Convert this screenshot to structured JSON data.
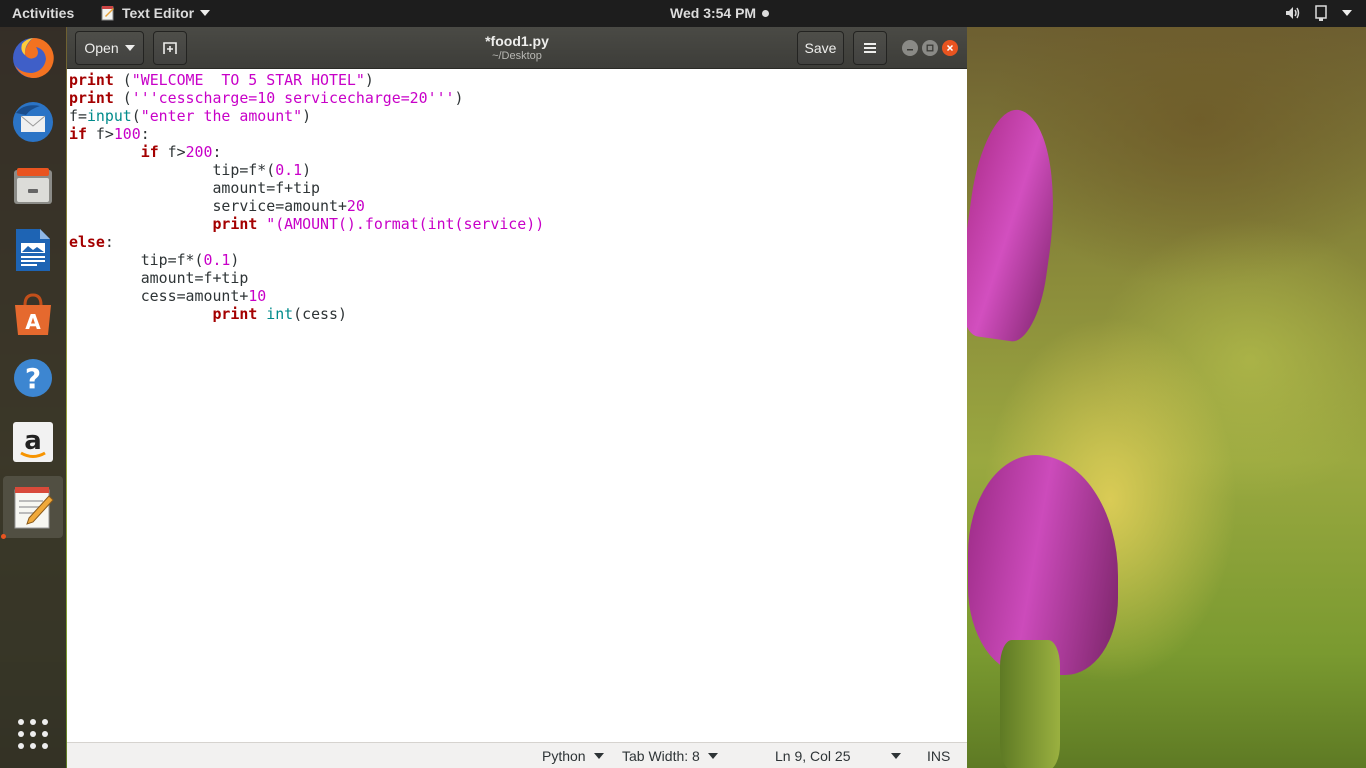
{
  "topbar": {
    "activities": "Activities",
    "app_name": "Text Editor",
    "clock": "Wed  3:54 PM"
  },
  "dock": {
    "items": [
      "firefox-icon",
      "thunderbird-icon",
      "files-icon",
      "libreoffice-writer-icon",
      "software-center-icon",
      "help-icon",
      "amazon-icon",
      "text-editor-icon"
    ],
    "show_apps": "show-applications-icon"
  },
  "window": {
    "open_label": "Open",
    "title": "*food1.py",
    "subtitle": "~/Desktop",
    "save_label": "Save"
  },
  "editor": {
    "lines": [
      "print (\"WELCOME  TO 5 STAR HOTEL\")",
      "print ('''cesscharge=10 servicecharge=20''')",
      "f=input(\"enter the amount\")",
      "if f>100:",
      "        if f>200:",
      "                tip=f*(0.1)",
      "                amount=f+tip",
      "                service=amount+20",
      "                print \"(AMOUNT().format(int(service))",
      "else:",
      "        tip=f*(0.1)",
      "        amount=f+tip",
      "        cess=amount+10",
      "                print int(cess)"
    ]
  },
  "statusbar": {
    "language": "Python",
    "tab_width": "Tab Width: 8",
    "position": "Ln 9, Col 25",
    "mode": "INS"
  },
  "colors": {
    "keyword": "#a40000",
    "string": "#c800c8",
    "builtin": "#008b8b",
    "accent": "#e95420"
  }
}
